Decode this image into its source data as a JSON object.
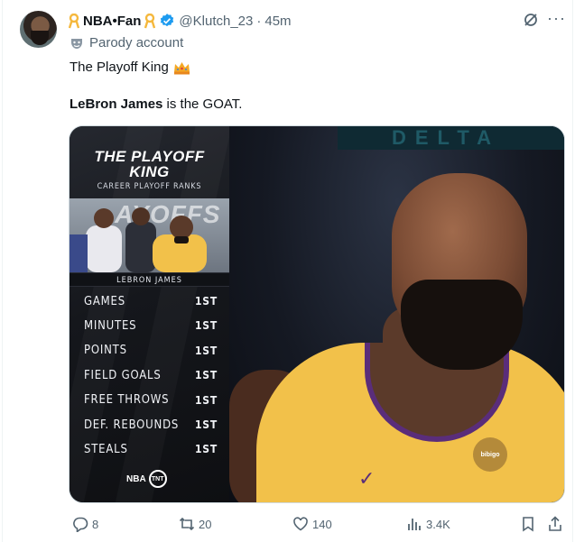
{
  "tweet": {
    "author_name": "NBA•Fan",
    "handle": "@Klutch_23",
    "separator": "·",
    "time": "45m",
    "parody_label": "Parody account",
    "text_line1": "The Playoff King",
    "text_line2_bold": "LeBron James",
    "text_line2_rest": " is the GOAT."
  },
  "graphic": {
    "title_line1": "THE PLAYOFF",
    "title_line2": "KING",
    "subtitle": "CAREER PLAYOFF RANKS",
    "photo_backdrop_text": "AYOFFS",
    "player_name": "LEBRON JAMES",
    "stats": [
      {
        "label": "GAMES",
        "rank": "1ST"
      },
      {
        "label": "MINUTES",
        "rank": "1ST"
      },
      {
        "label": "POINTS",
        "rank": "1ST"
      },
      {
        "label": "FIELD GOALS",
        "rank": "1ST"
      },
      {
        "label": "FREE THROWS",
        "rank": "1ST"
      },
      {
        "label": "DEF. REBOUNDS",
        "rank": "1ST"
      },
      {
        "label": "STEALS",
        "rank": "1ST"
      }
    ],
    "logo_nba": "NBA",
    "logo_tnt": "TNT"
  },
  "photo": {
    "sign_text": "DELTA",
    "patch_text": "bibigo"
  },
  "actions": {
    "replies": "8",
    "reposts": "20",
    "likes": "140",
    "views": "3.4K"
  },
  "colors": {
    "verified_blue": "#1d9bf0",
    "ribbon_gold": "#f5b83d",
    "muted_text": "#536471"
  },
  "icons": [
    "ribbon-icon",
    "verified-badge-icon",
    "grok-icon",
    "more-icon",
    "parody-mask-icon",
    "crown-icon",
    "reply-icon",
    "repost-icon",
    "like-icon",
    "views-icon",
    "bookmark-icon",
    "share-icon"
  ]
}
